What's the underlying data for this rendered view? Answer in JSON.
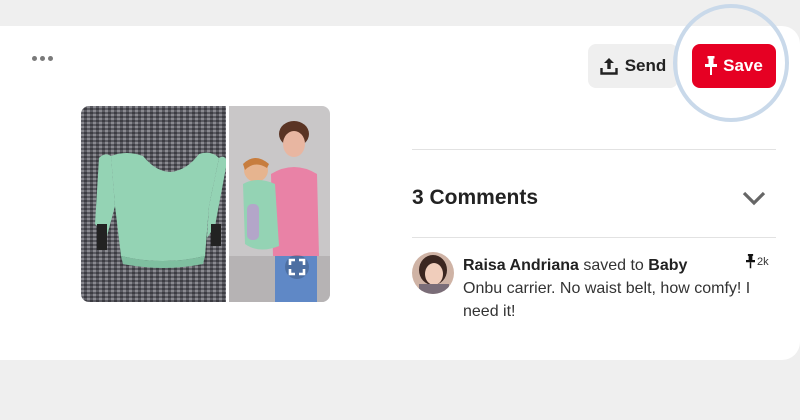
{
  "toolbar": {
    "more_icon": "ellipsis-icon",
    "send_label": "Send",
    "send_icon": "upload-icon",
    "save_label": "Save",
    "save_icon": "pushpin-icon"
  },
  "pin": {
    "image": "baby-carrier-photo",
    "expand_icon": "expand-icon"
  },
  "comments": {
    "title": "3 Comments",
    "toggle_icon": "chevron-down-icon",
    "items": [
      {
        "author": "Raisa Andriana",
        "action": " saved to ",
        "board": "Baby",
        "text": "Onbu carrier. No waist belt, how comfy! I need it!",
        "saves": "2k",
        "saves_icon": "pushpin-icon"
      }
    ]
  },
  "colors": {
    "save_red": "#e60023",
    "send_gray": "#efefef",
    "highlight_ring": "#c9d9ea",
    "carrier_mint": "#94d3b4"
  }
}
